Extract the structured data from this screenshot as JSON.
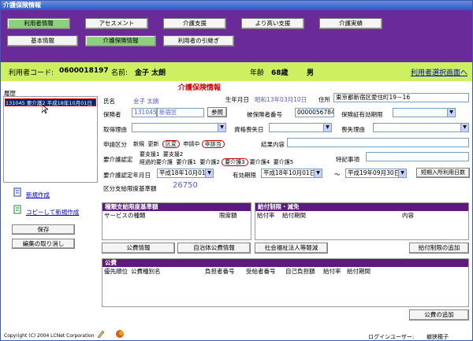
{
  "window": {
    "title": "介護保険情報"
  },
  "topnav": {
    "row1": [
      "利用者情報",
      "アセスメント",
      "介護支援",
      "より高い支援",
      "介護実績"
    ],
    "row2": [
      "基本情報",
      "介護保険情報",
      "利用者の引継ぎ"
    ]
  },
  "userbar": {
    "code_label": "利用者コード:",
    "code": "0600018197",
    "name_label": "名前:",
    "name": "金子 太朗",
    "age_label": "年齢",
    "age": "68歳",
    "sex": "男",
    "back_link": "利用者選択画面へ"
  },
  "history": {
    "title": "履歴",
    "items": [
      "131045 要介護2 平成18年10月01日"
    ],
    "new_btn": "新規作成",
    "copy_btn": "コピーして新規作成",
    "save_btn": "保存",
    "cancel_btn": "編集の取り消し"
  },
  "form": {
    "title": "介護保険情報",
    "name_label": "氏名",
    "name_value": "金子 太朗",
    "birth_label": "生年月日",
    "birth_value": "昭和13年03月10日",
    "address_label": "住所",
    "address_value": "東京都新宿区愛住町19－16",
    "insurer_label": "保険者",
    "insurer_code": "131045",
    "insurer_name": "新宿区",
    "ref_btn": "参照",
    "insured_no_label": "被保険者番号",
    "insured_no": "0000056784",
    "valid_label": "保険証有効期限",
    "acquire_label": "取得理由",
    "lose_label": "資格喪失日",
    "lose_reason_label": "喪失理由",
    "apply_label": "申請区分",
    "apply_opts": [
      "新規",
      "更新",
      "区変",
      "申請中",
      "非該当"
    ],
    "result_label": "結果内容",
    "cert_label": "要介護認定",
    "cert_row1": [
      "要支援1",
      "要支援2"
    ],
    "cert_row2": [
      "経過的要介護",
      "要介護1",
      "要介護2",
      "要介護3",
      "要介護4",
      "要介護5"
    ],
    "special_label": "特記事項",
    "cert_date_label": "要介護認定年月日",
    "cert_date": "平成18年10月01日",
    "valid_period_label": "有効期限",
    "valid_from": "平成18年10月01日",
    "tilde": "～",
    "valid_to": "平成19年09月30日",
    "short_stay_btn": "短期入所利用日数",
    "limit_label": "区分支給限度基準額",
    "limit_value": "26750"
  },
  "limits": {
    "title": "種類支給限度基準額",
    "cols": [
      "サービスの種類",
      "限度額"
    ]
  },
  "benefit": {
    "title": "給付制限・減免",
    "cols": [
      "給付率",
      "給付期間",
      "内容"
    ]
  },
  "actions": {
    "public_btn": "公費情報",
    "local_btn": "自治体公費情報",
    "welfare_btn": "社会福祉法人等軽減",
    "add_limit_btn": "給付制限の追加"
  },
  "public": {
    "title": "公費",
    "cols": [
      "優先順位",
      "公費種別名",
      "負担者番号",
      "受給者番号",
      "自己負担額",
      "給付率",
      "給付期間"
    ],
    "add_btn": "公費の追加"
  },
  "footer": {
    "copyright": "Copyright (C) 2004 LCNet Corporation",
    "login_label": "ログインユーザー:",
    "login_user": "撤狭穂子"
  },
  "colors": {
    "nav": "#6a2a9a",
    "bar": "#ccf060",
    "accent": "#5c1a7e",
    "selected": "#0a246a"
  }
}
